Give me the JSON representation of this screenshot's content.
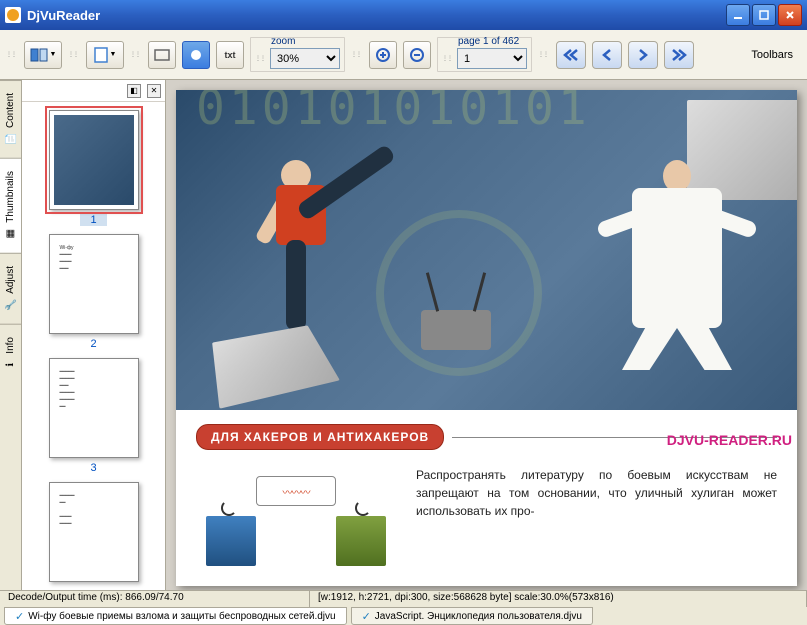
{
  "titlebar": {
    "app_name": "DjVuReader"
  },
  "toolbar": {
    "zoom_label": "zoom",
    "zoom_value": "30%",
    "page_label": "page 1 of 462",
    "page_value": "1",
    "toolbars_label": "Toolbars",
    "txt_btn": "txt"
  },
  "side_tabs": {
    "content": "Content",
    "thumbnails": "Thumbnails",
    "adjust": "Adjust",
    "info": "Info"
  },
  "thumbs": {
    "numbers": [
      "1",
      "2",
      "3"
    ]
  },
  "page": {
    "banner": "ДЛЯ ХАКЕРОВ И АНТИХАКЕРОВ",
    "watermark": "DJVU-READER.RU",
    "paragraph": "Распространять литературу по боевым искус­ствам не запрещают на том основании, что уличный хулиган может использовать их про-"
  },
  "status": {
    "decode": "Decode/Output time (ms): 866.09/74.70",
    "info": "[w:1912, h:2721, dpi:300, size:568628 byte] scale:30.0%(573x816)"
  },
  "doc_tabs": {
    "tab1": "Wi-фу боевые приемы взлома и защиты беспроводных сетей.djvu",
    "tab2": "JavaScript. Энциклопедия пользователя.djvu"
  }
}
